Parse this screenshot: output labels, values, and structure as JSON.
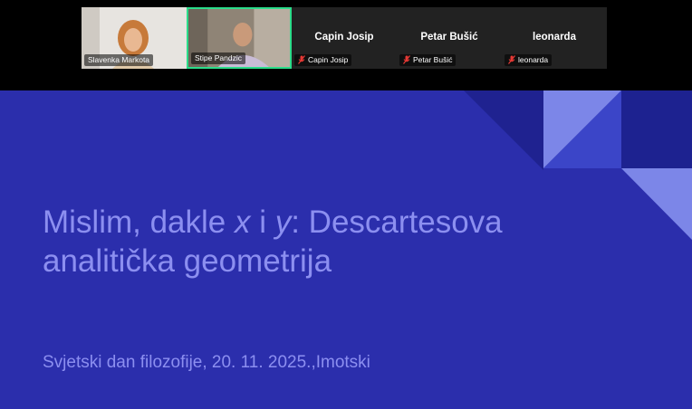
{
  "participants": [
    {
      "name": "Slavenka Markota",
      "has_video": true,
      "muted": false
    },
    {
      "name": "Stipe Pandzic",
      "has_video": true,
      "muted": false,
      "active_speaker": true
    },
    {
      "name": "Capin Josip",
      "has_video": false,
      "muted": true
    },
    {
      "name": "Petar Bušić",
      "has_video": false,
      "muted": true
    },
    {
      "name": "leonarda",
      "has_video": false,
      "muted": true
    }
  ],
  "slide": {
    "title_part1": "Mislim, dakle ",
    "title_x": "x",
    "title_and": " i ",
    "title_y": "y",
    "title_part2": ": Descartesova",
    "title_line2": "analitička geometrija",
    "subtitle": "Svjetski dan filozofije, 20. 11. 2025.,Imotski"
  },
  "colors": {
    "slide_bg": "#2b2eac",
    "slide_text": "#8c8ff0",
    "active_speaker_border": "#2bdc8a",
    "muted_icon": "#e53935"
  }
}
